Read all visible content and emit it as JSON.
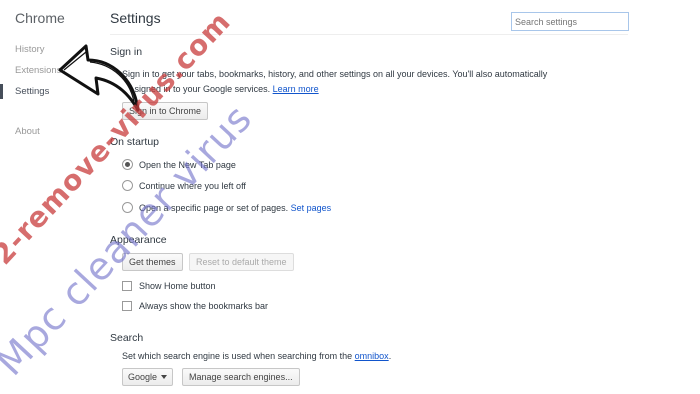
{
  "sidebar": {
    "brand": "Chrome",
    "items": [
      {
        "label": "History"
      },
      {
        "label": "Extensions"
      },
      {
        "label": "Settings"
      },
      {
        "label": "About"
      }
    ]
  },
  "header": {
    "title": "Settings",
    "search_placeholder": "Search settings"
  },
  "sign_in": {
    "title": "Sign in",
    "line1": "Sign in to get your tabs, bookmarks, history, and other settings on all your devices. You'll also automatically",
    "line2": "be signed in to your Google services.",
    "learn_more": "Learn more",
    "button": "Sign in to Chrome"
  },
  "startup": {
    "title": "On startup",
    "options": [
      {
        "label": "Open the New Tab page",
        "checked": true
      },
      {
        "label": "Continue where you left off",
        "checked": false
      },
      {
        "label": "Open a specific page or set of pages.",
        "checked": false
      }
    ],
    "set_pages": "Set pages"
  },
  "appearance": {
    "title": "Appearance",
    "get_themes": "Get themes",
    "reset_theme": "Reset to default theme",
    "show_home": "Show Home button",
    "show_bookmarks": "Always show the bookmarks bar"
  },
  "search": {
    "title": "Search",
    "desc": "Set which search engine is used when searching from the",
    "omnibox": "omnibox",
    "engine": "Google",
    "manage": "Manage search engines..."
  },
  "watermarks": {
    "red": "2-remove-virus.com",
    "blue": "Mpc cleaner virus"
  }
}
